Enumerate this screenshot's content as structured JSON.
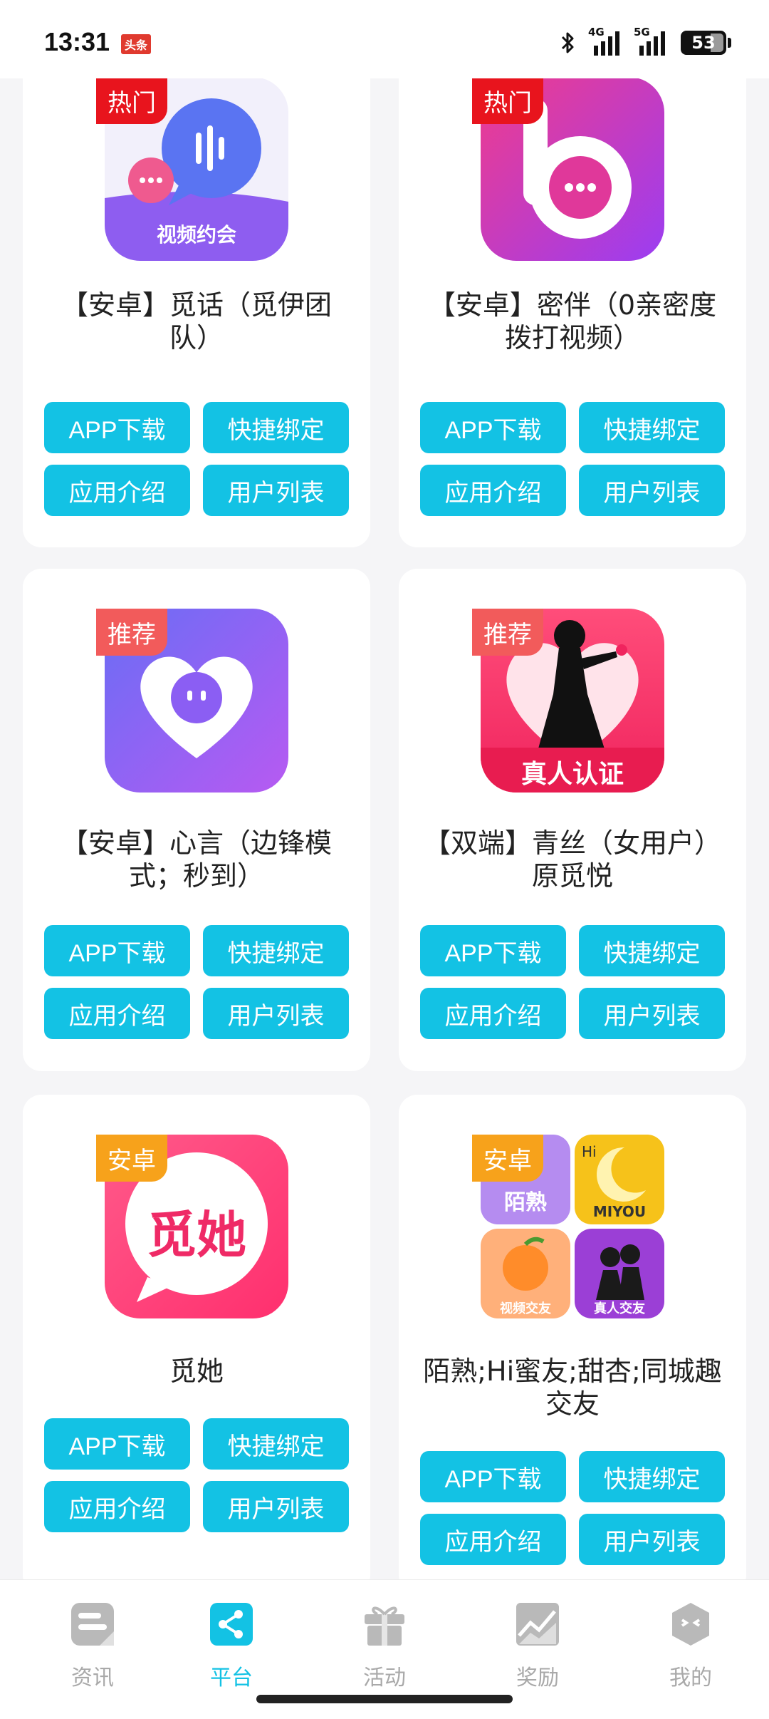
{
  "status_bar": {
    "time": "13:31",
    "badge": "头条",
    "net1": "4G",
    "net2": "5G",
    "battery": "53",
    "icons": [
      "bluetooth-icon",
      "signal-icon",
      "battery-icon"
    ]
  },
  "buttons": {
    "download": "APP下载",
    "bind": "快捷绑定",
    "intro": "应用介绍",
    "users": "用户列表"
  },
  "cards": [
    {
      "tag": "热门",
      "tag_color": "#e8141d",
      "title_line1": "【安卓】觅话（觅伊团",
      "title_line2": "队）",
      "logo_text": "视频约会",
      "icon": "voice-chat-app-icon"
    },
    {
      "tag": "热门",
      "tag_color": "#e8141d",
      "title_line1": "【安卓】密伴（0亲密度",
      "title_line2": "拨打视频）",
      "logo_text": "",
      "icon": "b-chat-app-icon"
    },
    {
      "tag": "推荐",
      "tag_color": "#f25b5b",
      "title_line1": "【安卓】心言（边锋模",
      "title_line2": "式；秒到）",
      "logo_text": "",
      "icon": "heart-chat-app-icon"
    },
    {
      "tag": "推荐",
      "tag_color": "#f25b5b",
      "title_line1": "【双端】青丝（女用户）",
      "title_line2": "原觅悦",
      "logo_text": "真人认证",
      "icon": "woman-silhouette-app-icon"
    },
    {
      "tag": "安卓",
      "tag_color": "#f7a21b",
      "title_line1": "觅她",
      "title_line2": "",
      "logo_text": "觅她",
      "icon": "mita-app-icon"
    },
    {
      "tag": "安卓",
      "tag_color": "#f7a21b",
      "title_line1": "陌熟;Hi蜜友;甜杏;同城趣",
      "title_line2": "交友",
      "logo_text": "",
      "icon": "app-collage-icon",
      "tiles": [
        "陌熟",
        "Hi",
        "MIYOU",
        "视频交友",
        "真人交友"
      ]
    }
  ],
  "nav": [
    {
      "label": "资讯",
      "icon": "news-icon",
      "active": false
    },
    {
      "label": "平台",
      "icon": "share-platform-icon",
      "active": true
    },
    {
      "label": "活动",
      "icon": "gift-icon",
      "active": false
    },
    {
      "label": "奖励",
      "icon": "chart-reward-icon",
      "active": false
    },
    {
      "label": "我的",
      "icon": "profile-face-icon",
      "active": false
    }
  ],
  "colors": {
    "accent": "#13c2e4",
    "nav_inactive": "#a9a9a9"
  }
}
